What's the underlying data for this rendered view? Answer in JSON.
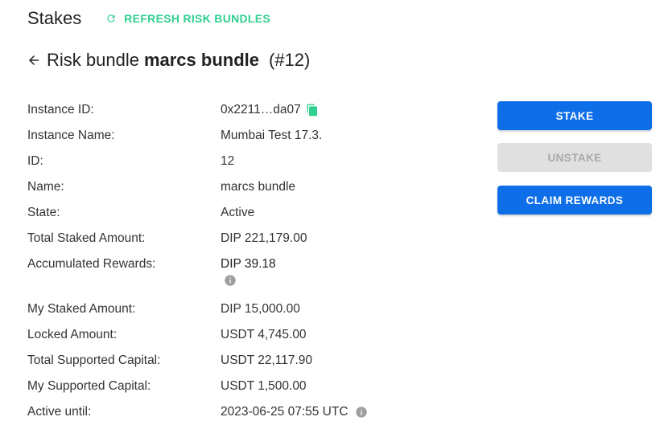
{
  "header": {
    "title": "Stakes",
    "refresh_label": "REFRESH RISK BUNDLES",
    "accent_color": "#2fd08f"
  },
  "bundle": {
    "prefix": "Risk bundle",
    "name": "marcs bundle",
    "id_label": "(#12)"
  },
  "details": {
    "instance_id": {
      "label": "Instance ID:",
      "value": "0x2211…da07"
    },
    "instance_name": {
      "label": "Instance Name:",
      "value": "Mumbai Test 17.3."
    },
    "id": {
      "label": "ID:",
      "value": "12"
    },
    "name": {
      "label": "Name:",
      "value": "marcs bundle"
    },
    "state": {
      "label": "State:",
      "value": "Active"
    },
    "total_staked": {
      "label": "Total Staked Amount:",
      "value": "DIP 221,179.00"
    },
    "accumulated_rewards": {
      "label": "Accumulated Rewards:",
      "value": "DIP 39.18"
    },
    "my_staked": {
      "label": "My Staked Amount:",
      "value": "DIP 15,000.00"
    },
    "locked_amount": {
      "label": "Locked Amount:",
      "value": "USDT 4,745.00"
    },
    "total_supported": {
      "label": "Total Supported Capital:",
      "value": "USDT 22,117.90"
    },
    "my_supported": {
      "label": "My Supported Capital:",
      "value": "USDT 1,500.00"
    },
    "active_until": {
      "label": "Active until:",
      "value": "2023-06-25 07:55 UTC"
    }
  },
  "actions": {
    "stake": "STAKE",
    "unstake": "UNSTAKE",
    "claim": "CLAIM REWARDS",
    "primary_color": "#0d6ee8"
  },
  "icons": {
    "refresh": "refresh-icon",
    "back": "arrow-left-icon",
    "copy": "copy-icon",
    "info": "info-icon"
  }
}
